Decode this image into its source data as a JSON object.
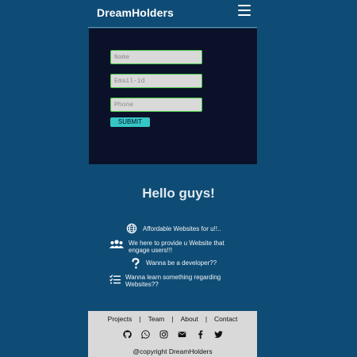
{
  "header": {
    "brand": "DreamHolders",
    "menu_icon": "hamburger-icon"
  },
  "form": {
    "name_placeholder": "Name",
    "email_placeholder": "Email-id",
    "phone_placeholder": "Phone",
    "submit_label": "SUBMIT",
    "field_border_color": "#45c845",
    "submit_color": "#35c6c6"
  },
  "main": {
    "greeting": "Hello guys!",
    "features": [
      {
        "icon": "globe-icon",
        "text": "Affordable Websites for u!!.."
      },
      {
        "icon": "users-icon",
        "text": "We here to provide u Website that engage users!!!"
      },
      {
        "icon": "question-icon",
        "text": "Wanna be a developer??"
      },
      {
        "icon": "checklist-icon",
        "text": "Wanna learn something regarding Websites??"
      }
    ]
  },
  "footer": {
    "nav": [
      "Projects",
      "Team",
      "About",
      "Contact"
    ],
    "socials": [
      "github-icon",
      "whatsapp-icon",
      "instagram-icon",
      "email-icon",
      "facebook-icon",
      "twitter-icon"
    ],
    "copyright": "@copyright DreamHolders"
  },
  "colors": {
    "background": "#0f4c75",
    "form_panel": "#0b1128",
    "footer": "#d9d9d9"
  }
}
